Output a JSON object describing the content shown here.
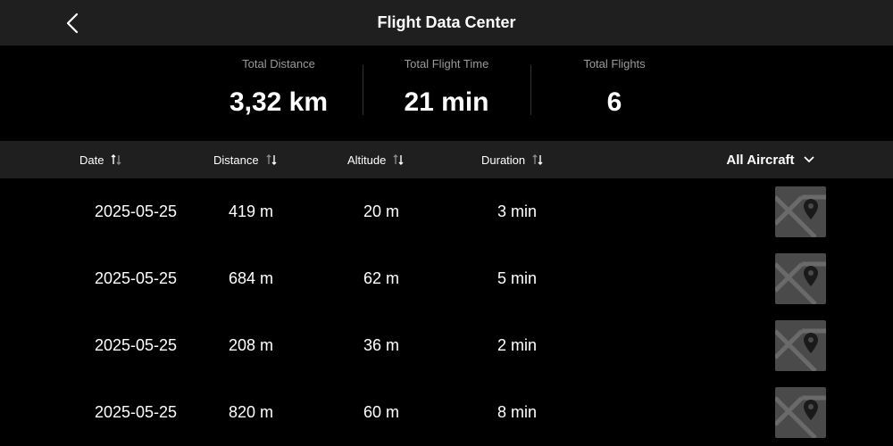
{
  "header": {
    "title": "Flight Data Center"
  },
  "summary": [
    {
      "label": "Total Distance",
      "value": "3,32 km"
    },
    {
      "label": "Total Flight Time",
      "value": "21 min"
    },
    {
      "label": "Total Flights",
      "value": "6"
    }
  ],
  "columns": {
    "date": "Date",
    "distance": "Distance",
    "altitude": "Altitude",
    "duration": "Duration"
  },
  "filter": {
    "label": "All Aircraft"
  },
  "rows": [
    {
      "date": "2025-05-25",
      "distance": "419 m",
      "altitude": "20 m",
      "duration": "3 min"
    },
    {
      "date": "2025-05-25",
      "distance": "684 m",
      "altitude": "62 m",
      "duration": "5 min"
    },
    {
      "date": "2025-05-25",
      "distance": "208 m",
      "altitude": "36 m",
      "duration": "2 min"
    },
    {
      "date": "2025-05-25",
      "distance": "820 m",
      "altitude": "60 m",
      "duration": "8 min"
    }
  ],
  "colors": {
    "header_bg": "#1f1f1f",
    "background": "#000000",
    "thumb_bg": "#4a4a4a"
  },
  "icons": {
    "back": "chevron-left-icon",
    "sort": "sort-icon",
    "dropdown": "chevron-down-icon",
    "map": "map-pin-icon"
  }
}
